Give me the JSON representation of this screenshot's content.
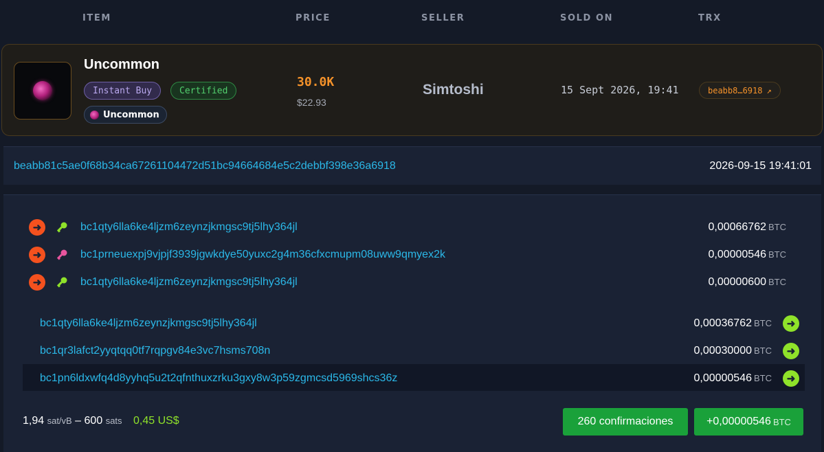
{
  "header": {
    "col_item": "ITEM",
    "col_price": "PRICE",
    "col_seller": "SELLER",
    "col_sold_on": "SOLD ON",
    "col_trx": "TRX"
  },
  "item": {
    "title": "Uncommon",
    "badge_instant": "Instant Buy",
    "badge_certified": "Certified",
    "rarity": "Uncommon",
    "price": "30.0K",
    "price_usd": "$22.93",
    "seller": "Simtoshi",
    "sold_on": "15 Sept 2026, 19:41",
    "trx_short": "beabb8…6918",
    "trx_icon": "external-arrow-icon"
  },
  "tx": {
    "hash": "beabb81c5ae0f68b34ca67261104472d51bc94664684e5c2debbf398e36a6918",
    "time": "2026-09-15 19:41:01",
    "unit": "BTC",
    "inputs": [
      {
        "address": "bc1qty6lla6ke4ljzm6zeynzjkmgsc9tj5lhy364jl",
        "amount": "0,00066762",
        "key_color": "#8fe22a"
      },
      {
        "address": "bc1prneuexpj9vjpjf3939jgwkdye50yuxc2g4m36cfxcmupm08uww9qmyex2k",
        "amount": "0,00000546",
        "key_color": "#e8559e"
      },
      {
        "address": "bc1qty6lla6ke4ljzm6zeynzjkmgsc9tj5lhy364jl",
        "amount": "0,00000600",
        "key_color": "#8fe22a"
      }
    ],
    "outputs": [
      {
        "address": "bc1qty6lla6ke4ljzm6zeynzjkmgsc9tj5lhy364jl",
        "amount": "0,00036762"
      },
      {
        "address": "bc1qr3lafct2yyqtqq0tf7rqpgv84e3vc7hsms708n",
        "amount": "0,00030000"
      },
      {
        "address": "bc1pn6ldxwfq4d8yyhq5u2t2qfnthuxzrku3gxy8w3p59zgmcsd5969shcs36z",
        "amount": "0,00000546"
      }
    ],
    "fee_rate": "1,94",
    "fee_rate_unit": "sat/vB",
    "fee_sep": "–",
    "fee_sats": "600",
    "fee_sats_unit": "sats",
    "fee_usd": "0,45 US$",
    "confirmations": "260 confirmaciones",
    "net_change": "+0,00000546"
  },
  "colors": {
    "accent_orange": "#f5922a",
    "link_blue": "#2bb8e8",
    "confirm_green": "#1aa13a",
    "input_arrow": "#f4511e",
    "output_arrow": "#8fe22a"
  }
}
